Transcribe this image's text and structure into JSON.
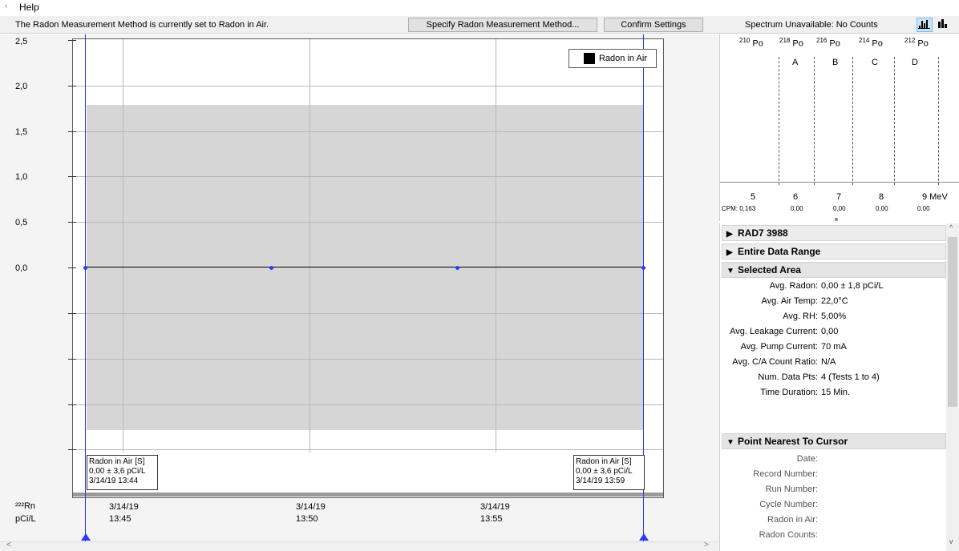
{
  "menu": {
    "help": "Help"
  },
  "toolbar": {
    "status": "The Radon Measurement Method is currently set to Radon in Air.",
    "specify_button": "Specify Radon Measurement Method...",
    "confirm_button": "Confirm Settings",
    "spectrum_status": "Spectrum Unavailable: No Counts"
  },
  "chart": {
    "y_ticks": [
      "2,5",
      "2,0",
      "1,5",
      "1,0",
      "0,5",
      "0,0"
    ],
    "y_unit_line1": "²²²Rn",
    "y_unit_line2": "pCi/L",
    "x_ticks": [
      {
        "date": "3/14/19",
        "time": "13:45"
      },
      {
        "date": "3/14/19",
        "time": "13:50"
      },
      {
        "date": "3/14/19",
        "time": "13:55"
      }
    ],
    "legend": "Radon in Air",
    "cursor_left": {
      "l1": "Radon in Air [S]",
      "l2": "0,00 ± 3,6 pCi/L",
      "l3": "3/14/19 13:44"
    },
    "cursor_right": {
      "l1": "Radon in Air [S]",
      "l2": "0,00 ± 3,6 pCi/L",
      "l3": "3/14/19 13:59"
    },
    "colors": {
      "band": "#d6d6d6",
      "cursor": "#2a3aff",
      "line": "#000000"
    }
  },
  "chart_data": {
    "type": "line",
    "title": "",
    "xlabel": "",
    "ylabel": "²²²Rn pCi/L",
    "ylim": [
      -2.5,
      2.5
    ],
    "x": [
      "3/14/19 13:44",
      "3/14/19 13:49",
      "3/14/19 13:54",
      "3/14/19 13:59"
    ],
    "series": [
      {
        "name": "Radon in Air",
        "values": [
          0.0,
          0.0,
          0.0,
          0.0
        ]
      }
    ],
    "uncertainty_band": [
      -1.8,
      1.8
    ],
    "grid": true,
    "legend": "top-right"
  },
  "spectrum": {
    "isotopes": [
      "210",
      "218",
      "216",
      "214",
      "212"
    ],
    "isotope_symbol": "Po",
    "regions": [
      "A",
      "B",
      "C",
      "D"
    ],
    "mev": [
      "5",
      "6",
      "7",
      "8",
      "9 MeV"
    ],
    "cpm": [
      "CPM: 0,163",
      "0,00",
      "0,00",
      "0,00",
      "0,00"
    ]
  },
  "panel": {
    "sections": {
      "device": "RAD7 3988",
      "range": "Entire Data Range",
      "selected": "Selected Area",
      "nearest": "Point Nearest To Cursor"
    },
    "selected": [
      {
        "label": "Avg. Radon:",
        "value": "0,00 ± 1,8 pCi/L"
      },
      {
        "label": "Avg. Air Temp:",
        "value": "22,0°C"
      },
      {
        "label": "Avg. RH:",
        "value": "5,00%"
      },
      {
        "label": "Avg. Leakage Current:",
        "value": "0,00"
      },
      {
        "label": "Avg. Pump Current:",
        "value": "70 mA"
      },
      {
        "label": "Avg. C/A Count Ratio:",
        "value": "N/A"
      },
      {
        "label": "Num. Data Pts:",
        "value": "4 (Tests 1 to 4)"
      },
      {
        "label": "Time Duration:",
        "value": "15 Min."
      }
    ],
    "nearest": [
      "Date:",
      "Record Number:",
      "Run Number:",
      "Cycle Number:",
      "Radon in Air:",
      "Radon Counts:"
    ]
  }
}
